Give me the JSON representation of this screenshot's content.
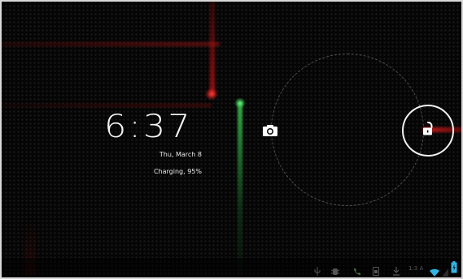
{
  "lockscreen": {
    "time": "6:37",
    "date": "Thu, March 8",
    "charging_status": "Charging, 95%"
  },
  "targets": {
    "camera_icon": "camera-icon",
    "unlock_icon": "unlock-padlock-icon"
  },
  "statusbar": {
    "time": "1:3 A",
    "battery_level": 0.95,
    "icons": [
      "usb-icon",
      "debug-icon",
      "phone-icon",
      "screenshot-icon",
      "download-icon",
      "wifi-icon",
      "battery-charging-icon"
    ]
  },
  "colors": {
    "accent_red": "#d92020",
    "accent_green": "#3ac85a",
    "wifi_blue": "#33b5e5",
    "text": "#f4f4f4"
  }
}
